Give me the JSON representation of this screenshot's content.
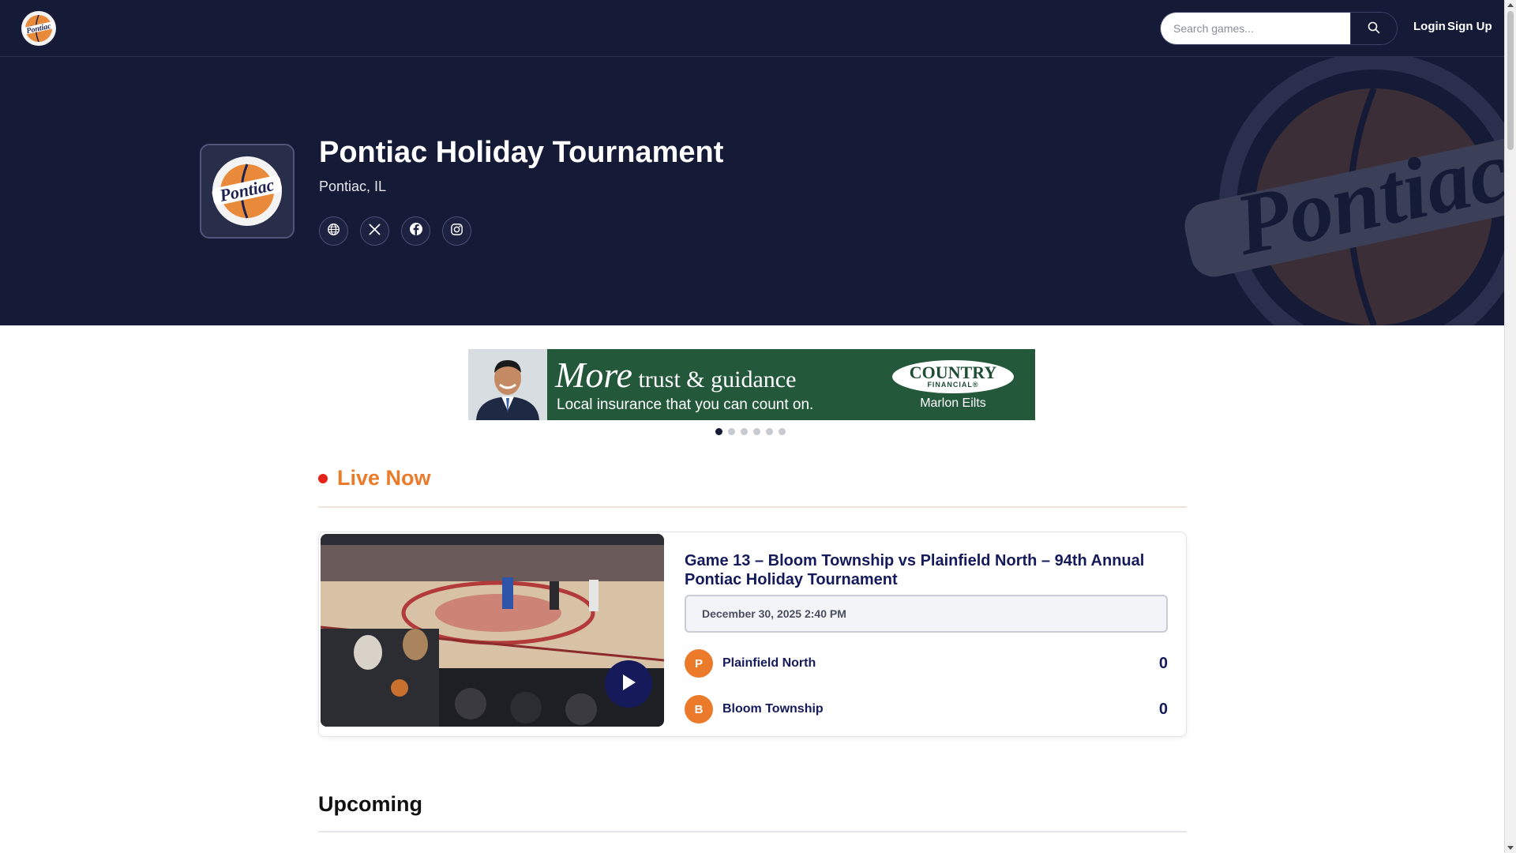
{
  "nav": {
    "logo_icon": "pontiac-logo",
    "search_placeholder": "Search games...",
    "search_icon": "search-icon",
    "login_label": "Login",
    "signup_label": "Sign Up"
  },
  "hero": {
    "title": "Pontiac Holiday Tournament",
    "location": "Pontiac, IL",
    "logo_text": "Pontiac",
    "social": [
      {
        "icon": "globe-icon"
      },
      {
        "icon": "x-twitter-icon"
      },
      {
        "icon": "facebook-icon"
      },
      {
        "icon": "instagram-icon"
      }
    ]
  },
  "ad": {
    "headline_more": "More",
    "headline_rest": " trust & guidance",
    "subline": "Local insurance that you can count on.",
    "brand_name": "COUNTRY",
    "brand_sub": "FINANCIAL®",
    "agent_name": "Marlon Eilts",
    "slide_count": 6,
    "active_slide": 1
  },
  "live": {
    "section_title": "Live Now",
    "game": {
      "title": "Game 13 – Bloom Township vs Plainfield North – 94th Annual Pontiac Holiday Tournament",
      "date": "December 30, 2025 2:40 PM",
      "teams": [
        {
          "initial": "P",
          "name": "Plainfield North",
          "score": "0"
        },
        {
          "initial": "B",
          "name": "Bloom Township",
          "score": "0"
        }
      ]
    }
  },
  "upcoming": {
    "section_title": "Upcoming"
  },
  "colors": {
    "navy": "#151a36",
    "accent_orange": "#ec7a2b",
    "live_red": "#e5231b",
    "ad_green": "#23583a"
  }
}
